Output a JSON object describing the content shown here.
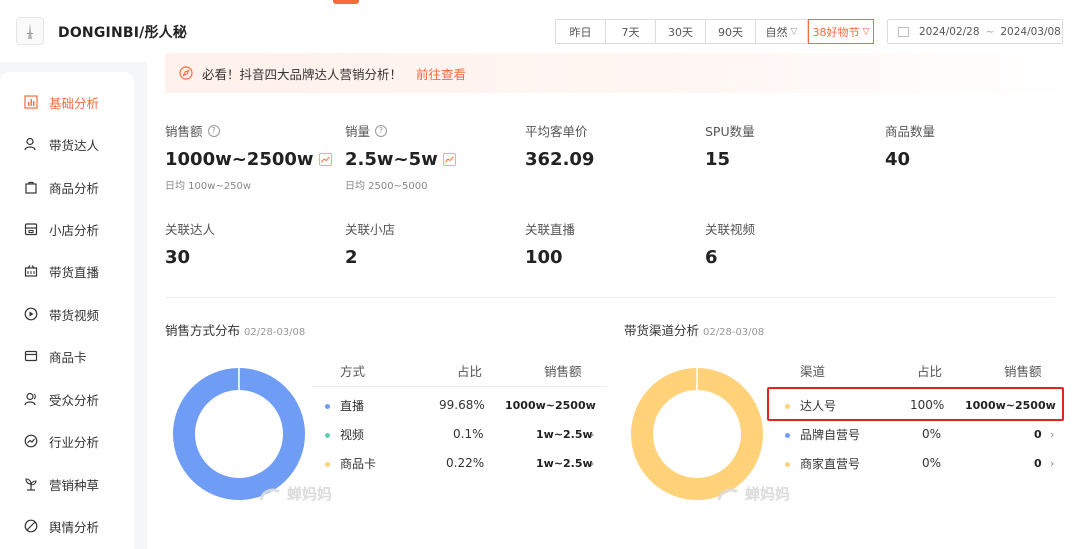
{
  "header": {
    "brand": "DONGINBI/彤人秘",
    "ranges": [
      {
        "label": "昨日",
        "active": false
      },
      {
        "label": "7天",
        "active": false
      },
      {
        "label": "30天",
        "active": false
      },
      {
        "label": "90天",
        "active": false
      }
    ],
    "natural_label": "自然",
    "festival_label": "38好物节",
    "date_start": "2024/02/28",
    "date_sep": "~",
    "date_end": "2024/03/08"
  },
  "sidebar": {
    "items": [
      {
        "label": "基础分析",
        "icon": "bar-chart-icon",
        "active": true
      },
      {
        "label": "带货达人",
        "icon": "user-icon",
        "active": false
      },
      {
        "label": "商品分析",
        "icon": "shopping-bag-icon",
        "active": false
      },
      {
        "label": "小店分析",
        "icon": "store-icon",
        "active": false
      },
      {
        "label": "带货直播",
        "icon": "live-icon",
        "active": false
      },
      {
        "label": "带货视频",
        "icon": "play-icon",
        "active": false
      },
      {
        "label": "商品卡",
        "icon": "card-icon",
        "active": false
      },
      {
        "label": "受众分析",
        "icon": "audience-icon",
        "active": false
      },
      {
        "label": "行业分析",
        "icon": "trend-icon",
        "active": false
      },
      {
        "label": "营销种草",
        "icon": "sprout-icon",
        "active": false
      },
      {
        "label": "舆情分析",
        "icon": "sentiment-icon",
        "active": false
      }
    ]
  },
  "notice": {
    "text": "必看！抖音四大品牌达人营销分析！",
    "link": "前往查看"
  },
  "metrics": {
    "sales_amount": {
      "label": "销售额",
      "value": "1000w~2500w",
      "sub": "日均 100w~250w"
    },
    "sales_volume": {
      "label": "销量",
      "value": "2.5w~5w",
      "sub": "日均 2500~5000"
    },
    "avg_price": {
      "label": "平均客单价",
      "value": "362.09"
    },
    "spu": {
      "label": "SPU数量",
      "value": "15"
    },
    "product_count": {
      "label": "商品数量",
      "value": "40"
    },
    "influencers": {
      "label": "关联达人",
      "value": "30"
    },
    "shops": {
      "label": "关联小店",
      "value": "2"
    },
    "lives": {
      "label": "关联直播",
      "value": "100"
    },
    "videos": {
      "label": "关联视频",
      "value": "6"
    }
  },
  "sales_method": {
    "title": "销售方式分布",
    "date": "02/28-03/08",
    "headers": {
      "method": "方式",
      "share": "占比",
      "amount": "销售额"
    },
    "rows": [
      {
        "name": "直播",
        "share": "99.68%",
        "amount": "1000w~2500w",
        "color": "#6f9cf5",
        "pct": 99.68
      },
      {
        "name": "视频",
        "share": "0.1%",
        "amount": "1w~2.5w",
        "color": "#5fcfb1",
        "pct": 0.1
      },
      {
        "name": "商品卡",
        "share": "0.22%",
        "amount": "1w~2.5w",
        "color": "#ffd27a",
        "pct": 0.22
      }
    ]
  },
  "channel": {
    "title": "带货渠道分析",
    "date": "02/28-03/08",
    "headers": {
      "channel": "渠道",
      "share": "占比",
      "amount": "销售额"
    },
    "rows": [
      {
        "name": "达人号",
        "share": "100%",
        "amount": "1000w~2500w",
        "color": "#ffd27a",
        "pct": 100
      },
      {
        "name": "品牌自营号",
        "share": "0%",
        "amount": "0",
        "color": "#6f9cf5",
        "pct": 0
      },
      {
        "name": "商家直营号",
        "share": "0%",
        "amount": "0",
        "color": "#ffd27a",
        "pct": 0
      }
    ]
  },
  "watermark": "蝉妈妈",
  "colors": {
    "accent": "#fa6b3c",
    "highlight": "#e3261b"
  }
}
